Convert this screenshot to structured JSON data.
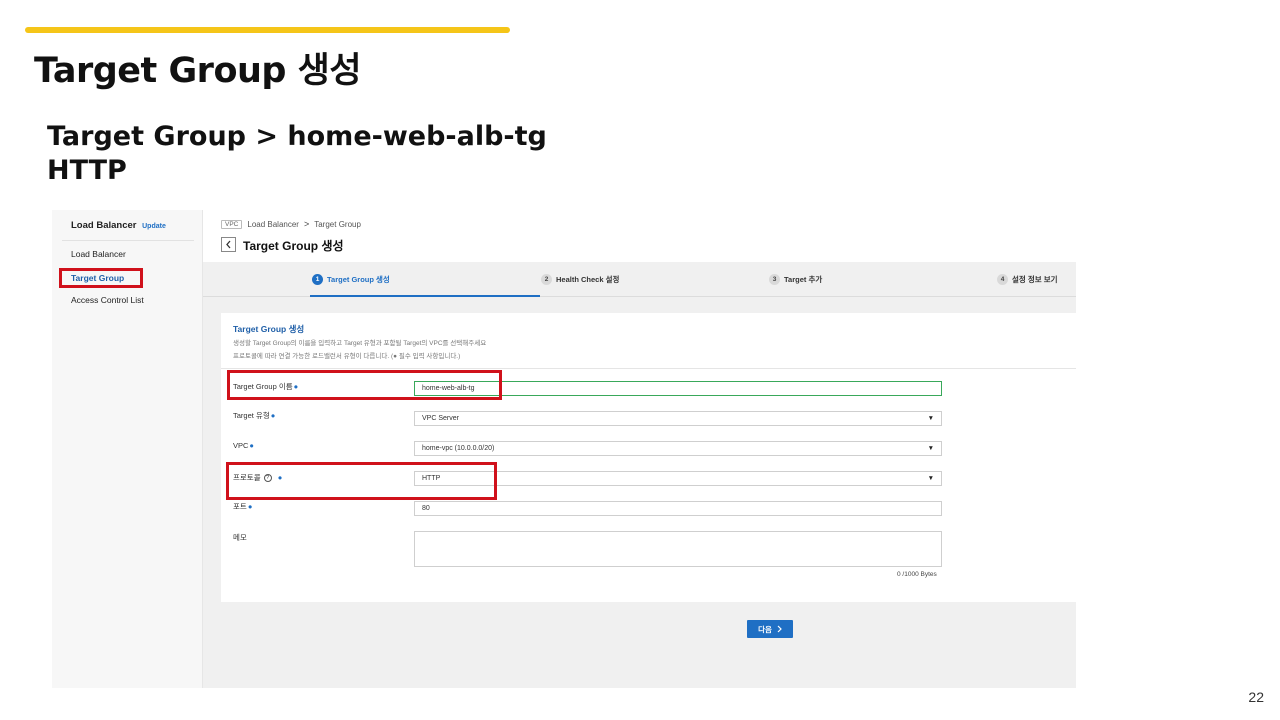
{
  "slide": {
    "title": "Target Group 생성",
    "subtitle_line1": "Target Group > home-web-alb-tg",
    "subtitle_line2": "HTTP",
    "page_number": "22",
    "accent_color": "#f5c518",
    "highlight_color": "#d0111b"
  },
  "console": {
    "sidebar": {
      "title": "Load Balancer",
      "update_badge": "Update",
      "items": [
        {
          "label": "Load Balancer",
          "active": false
        },
        {
          "label": "Target Group",
          "active": true
        },
        {
          "label": "Access Control List",
          "active": false
        }
      ]
    },
    "breadcrumb": {
      "tag": "VPC",
      "items": [
        "Load Balancer",
        "Target Group"
      ],
      "separator": ">"
    },
    "back_icon": "chevron-left-icon",
    "page_title": "Target Group 생성",
    "steps": [
      {
        "num": "1",
        "label": "Target Group 생성",
        "active": true
      },
      {
        "num": "2",
        "label": "Health Check 설정",
        "active": false
      },
      {
        "num": "3",
        "label": "Target 추가",
        "active": false
      },
      {
        "num": "4",
        "label": "설정 정보 보기",
        "active": false
      }
    ],
    "panel": {
      "title": "Target Group 생성",
      "desc_line1": "생성할 Target Group의 이름을 입력하고 Target 유형과 포함될 Target의 VPC를 선택해주세요",
      "desc_line2": "프로토콜에 따라 연결 가능한 로드밸런서 유형이 다릅니다. (● 필수 입력 사항입니다.)"
    },
    "form": {
      "name_label": "Target Group 이름",
      "name_value": "home-web-alb-tg",
      "type_label": "Target 유형",
      "type_value": "VPC Server",
      "vpc_label": "VPC",
      "vpc_value": "home-vpc (10.0.0.0/20)",
      "protocol_label": "프로토콜",
      "protocol_value": "HTTP",
      "port_label": "포트",
      "port_value": "80",
      "memo_label": "메모",
      "memo_value": "",
      "byte_count": "0 /1000 Bytes",
      "required_mark": "●",
      "dropdown_caret": "▼",
      "help_icon": "?"
    },
    "next_button": {
      "label": "다음",
      "icon": "chevron-right-icon",
      "color": "#1f6fc4"
    }
  }
}
